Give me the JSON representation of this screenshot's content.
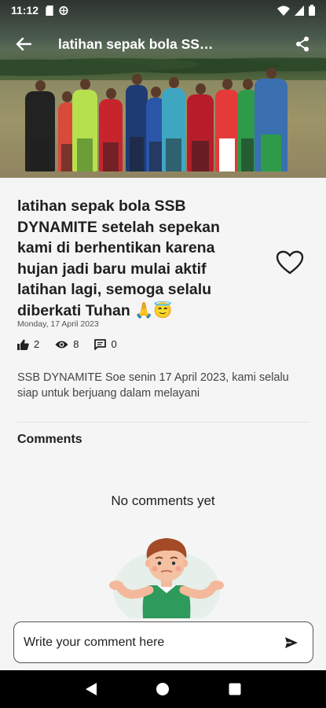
{
  "status_bar": {
    "time": "11:12",
    "icons_left": [
      "sd-card-icon",
      "data-saver-icon"
    ],
    "icons_right": [
      "wifi-icon",
      "signal-icon",
      "battery-icon"
    ]
  },
  "app_bar": {
    "title": "latihan sepak bola SSB ...",
    "back_icon": "arrow-back-icon",
    "share_icon": "share-icon"
  },
  "post": {
    "headline": "latihan sepak bola SSB DYNAMITE setelah sepekan kami di berhentikan karena hujan jadi baru mulai aktif latihan lagi, semoga selalu diberkati Tuhan 🙏😇",
    "date": "Monday, 17 April 2023",
    "likes": "2",
    "views": "8",
    "comments_count": "0",
    "description": "SSB DYNAMITE Soe senin 17 April 2023, kami selalu siap untuk berjuang dalam melayani"
  },
  "comments": {
    "title": "Comments",
    "empty_text": "No comments yet",
    "input_placeholder": "Write your comment here"
  },
  "colors": {
    "background": "#f5f5f5",
    "illustration_shirt": "#2e9a5c",
    "navbar": "#000000"
  }
}
